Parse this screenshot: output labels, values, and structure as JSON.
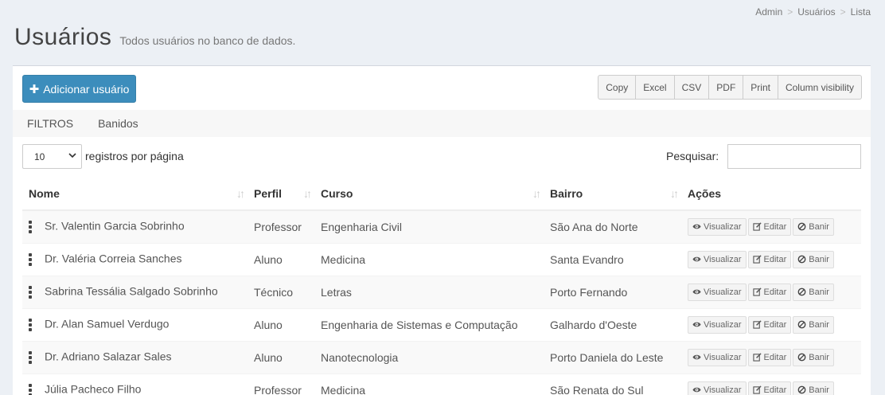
{
  "breadcrumb": [
    "Admin",
    "Usuários",
    "Lista"
  ],
  "page": {
    "title": "Usuários",
    "subtitle": "Todos usuários no banco de dados."
  },
  "toolbar": {
    "add_label": "Adicionar usuário",
    "export": [
      "Copy",
      "Excel",
      "CSV",
      "PDF",
      "Print",
      "Column visibility"
    ]
  },
  "filters": {
    "filtros_label": "FILTROS",
    "banidos_label": "Banidos"
  },
  "length": {
    "value": "10",
    "label": "registros por página"
  },
  "search": {
    "label": "Pesquisar:",
    "value": ""
  },
  "table": {
    "headers": [
      "Nome",
      "Perfil",
      "Curso",
      "Bairro",
      "Ações"
    ],
    "actions": [
      "Visualizar",
      "Editar",
      "Banir"
    ],
    "rows": [
      {
        "nome": "Sr. Valentin Garcia Sobrinho",
        "perfil": "Professor",
        "curso": "Engenharia Civil",
        "bairro": "São Ana do Norte"
      },
      {
        "nome": "Dr. Valéria Correia Sanches",
        "perfil": "Aluno",
        "curso": "Medicina",
        "bairro": "Santa Evandro"
      },
      {
        "nome": "Sabrina Tessália Salgado Sobrinho",
        "perfil": "Técnico",
        "curso": "Letras",
        "bairro": "Porto Fernando"
      },
      {
        "nome": "Dr. Alan Samuel Verdugo",
        "perfil": "Aluno",
        "curso": "Engenharia de Sistemas e Computação",
        "bairro": "Galhardo d'Oeste"
      },
      {
        "nome": "Dr. Adriano Salazar Sales",
        "perfil": "Aluno",
        "curso": "Nanotecnologia",
        "bairro": "Porto Daniela do Leste"
      },
      {
        "nome": "Júlia Pacheco Filho",
        "perfil": "Professor",
        "curso": "Medicina",
        "bairro": "São Renata do Sul"
      }
    ]
  }
}
